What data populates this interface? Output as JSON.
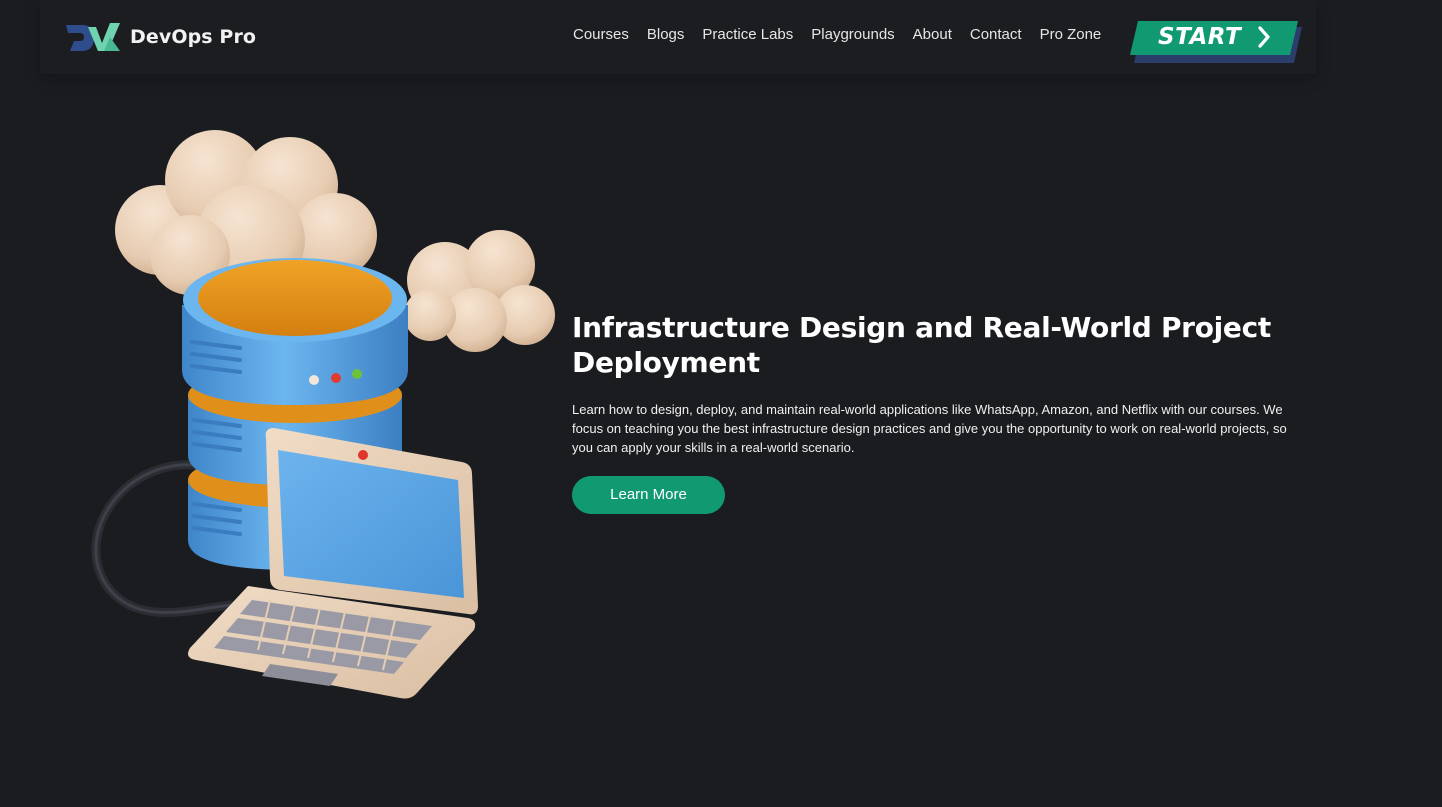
{
  "header": {
    "brand_name": "DevOps Pro",
    "logo_icon": "devops-pro-logo",
    "nav": [
      {
        "label": "Courses"
      },
      {
        "label": "Blogs"
      },
      {
        "label": "Practice Labs"
      },
      {
        "label": "Playgrounds"
      },
      {
        "label": "About"
      },
      {
        "label": "Contact"
      },
      {
        "label": "Pro Zone"
      }
    ],
    "start_label": "START",
    "start_icon": "chevron-right-icon"
  },
  "hero": {
    "illustration": "server-cloud-laptop-illustration",
    "title": "Infrastructure Design and Real-World Project Deployment",
    "description": "Learn how to design, deploy, and maintain real-world applications like WhatsApp, Amazon, and Netflix with our courses. We focus on teaching you the best infrastructure design practices and give you the opportunity to work on real-world projects, so you can apply your skills in a real-world scenario.",
    "cta_label": "Learn More"
  },
  "colors": {
    "background": "#1b1c20",
    "accent_green": "#119a72",
    "start_shadow": "#2a3d6b",
    "server_blue": "#5aa6e6",
    "server_top_orange": "#e0901a",
    "cloud": "#e8cfb6"
  }
}
